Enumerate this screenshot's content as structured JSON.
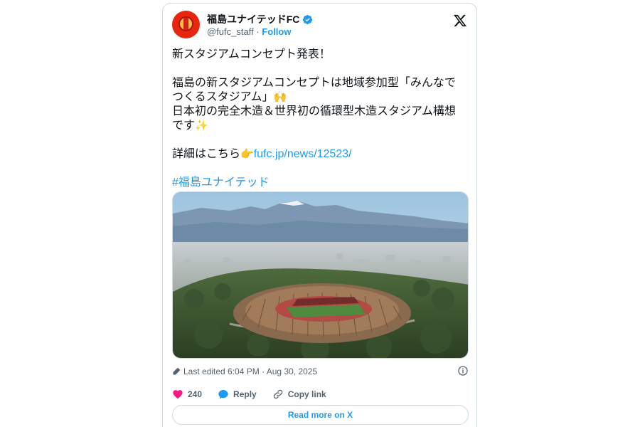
{
  "tweet": {
    "author_name": "福島ユナイテッドFC",
    "handle": "@fufc_staff",
    "separator": " · ",
    "follow_label": "Follow",
    "lines": [
      "新スタジアムコンセプト発表！",
      "福島の新スタジアムコンセプトは地域参加型「みんなで",
      "つくるスタジアム」",
      "日本初の完全木造＆世界初の循環型木造スタジアム構想",
      "です",
      "詳細はこちら",
      "fufc.jp/news/12523/",
      "#福島ユナイテッド"
    ],
    "emoji": {
      "raised_hands": "🙌",
      "sparkles": "✨",
      "pointing": "👉"
    },
    "media_alt": "Stadium aerial rendering",
    "edited_text": "Last edited 6:04 PM · Aug 30, 2025",
    "like_count": "240",
    "reply_label": "Reply",
    "copy_label": "Copy link",
    "read_more_label": "Read more on X"
  },
  "colors": {
    "link": "#1d9bf0",
    "like_heart": "#f91880",
    "text": "#0f1419",
    "secondary": "#536471",
    "border": "#cfd9de"
  },
  "icons": [
    "verified-badge-icon",
    "x-logo-icon",
    "pencil-icon",
    "info-icon",
    "heart-icon",
    "reply-bubble-icon",
    "link-icon"
  ]
}
